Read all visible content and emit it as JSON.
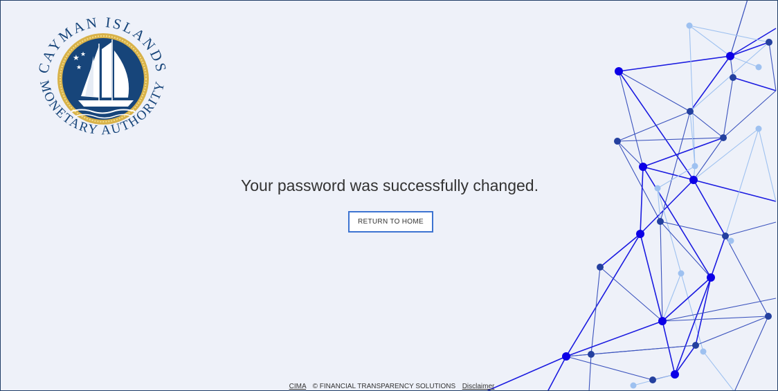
{
  "logo": {
    "top_text": "CAYMAN ISLANDS",
    "bottom_text": "MONETARY AUTHORITY",
    "icon": "sailing-ship-seal"
  },
  "main": {
    "message": "Your password was successfully changed.",
    "return_button": "RETURN TO HOME"
  },
  "footer": {
    "cima_link": "CIMA",
    "copyright": "© FINANCIAL TRANSPARENCY SOLUTIONS",
    "disclaimer_link": "Disclaimer"
  },
  "colors": {
    "background": "#eef1f9",
    "seal_navy": "#17457a",
    "seal_gold": "#d8b24a",
    "network_blue": "#1a1ae0",
    "button_border": "#3c73d1"
  }
}
